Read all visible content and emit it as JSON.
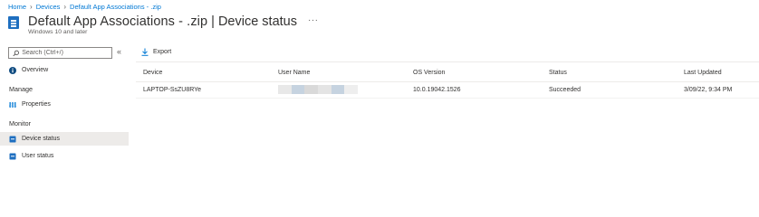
{
  "breadcrumb": {
    "items": [
      "Home",
      "Devices",
      "Default App Associations - .zip"
    ]
  },
  "header": {
    "title": "Default App Associations - .zip",
    "separator": "|",
    "subtitle": "Device status",
    "more": "···",
    "platform": "Windows 10 and later",
    "icon": "app-package-icon"
  },
  "sidebar": {
    "search_placeholder": "Search (Ctrl+/)",
    "collapse": "«",
    "overview": "Overview",
    "manage_label": "Manage",
    "properties": "Properties",
    "monitor_label": "Monitor",
    "device_status": "Device status",
    "user_status": "User status"
  },
  "toolbar": {
    "export_label": "Export"
  },
  "table": {
    "columns": [
      "Device",
      "User Name",
      "OS Version",
      "Status",
      "Last Updated"
    ],
    "rows": [
      {
        "device": "LAPTOP-SsZU8RYe",
        "user_name_redacted": true,
        "os_version": "10.0.19042.1526",
        "status": "Succeeded",
        "last_updated": "3/09/22, 9:34 PM"
      }
    ]
  },
  "colors": {
    "accent": "#0078d4",
    "selected_bg": "#edebe9",
    "app_icon": "#1e6fc0",
    "redaction": [
      "#e8e8e8",
      "#c6d3e0",
      "#d9d9d9",
      "#e4e4e4",
      "#c6d3e0",
      "#eeeeee"
    ]
  }
}
